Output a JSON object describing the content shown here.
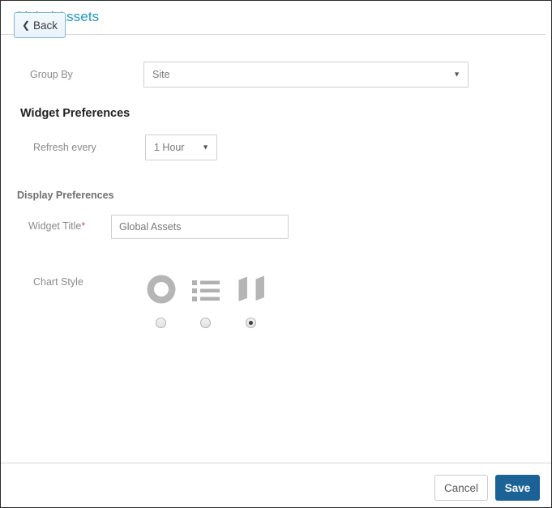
{
  "header": {
    "title": "Global Assets",
    "title_color": "#2196c8"
  },
  "form": {
    "group_by": {
      "label": "Group By",
      "value": "Site",
      "caret": "▼"
    },
    "widget_preferences": {
      "heading": "Widget Preferences",
      "refresh": {
        "label": "Refresh every",
        "value": "1 Hour",
        "caret": "▼"
      }
    },
    "display_preferences": {
      "heading": "Display Preferences",
      "widget_title": {
        "label": "Widget Title",
        "required_marker": "*",
        "value": "Global Assets",
        "placeholder": "Widget Title"
      },
      "chart_style": {
        "label": "Chart Style",
        "options": [
          {
            "name": "donut-chart",
            "icon": "donut-chart-icon",
            "selected": false
          },
          {
            "name": "list",
            "icon": "list-icon",
            "selected": false
          },
          {
            "name": "map",
            "icon": "map-icon",
            "selected": true
          }
        ]
      }
    }
  },
  "footer": {
    "back_label": "Back",
    "back_chevron": "❮",
    "cancel_label": "Cancel",
    "save_label": "Save",
    "save_color": "#1b6296"
  }
}
